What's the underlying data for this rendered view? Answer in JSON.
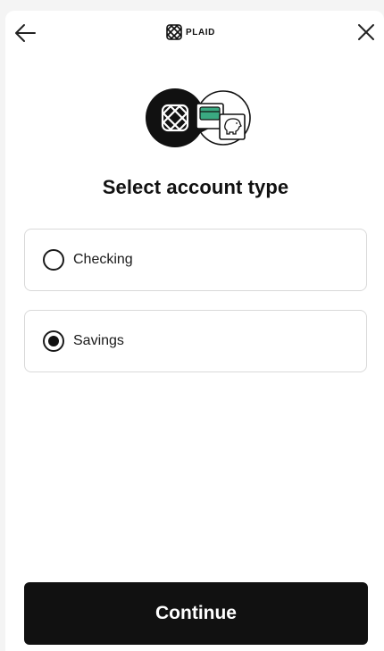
{
  "header": {
    "back_icon": "arrow-left-icon",
    "brand_logo_icon": "plaid-logo-icon",
    "brand_name": "PLAID",
    "close_icon": "close-icon"
  },
  "illustration": {
    "icons": [
      "plaid-logo-icon",
      "credit-card-icon",
      "piggy-bank-icon"
    ]
  },
  "title": "Select account type",
  "options": [
    {
      "label": "Checking",
      "selected": false
    },
    {
      "label": "Savings",
      "selected": true
    }
  ],
  "continue_label": "Continue",
  "colors": {
    "primary": "#111111",
    "card_green": "#3aa981",
    "border": "#d9d9d9",
    "background": "#ffffff",
    "backdrop": "#f4f4f4"
  }
}
